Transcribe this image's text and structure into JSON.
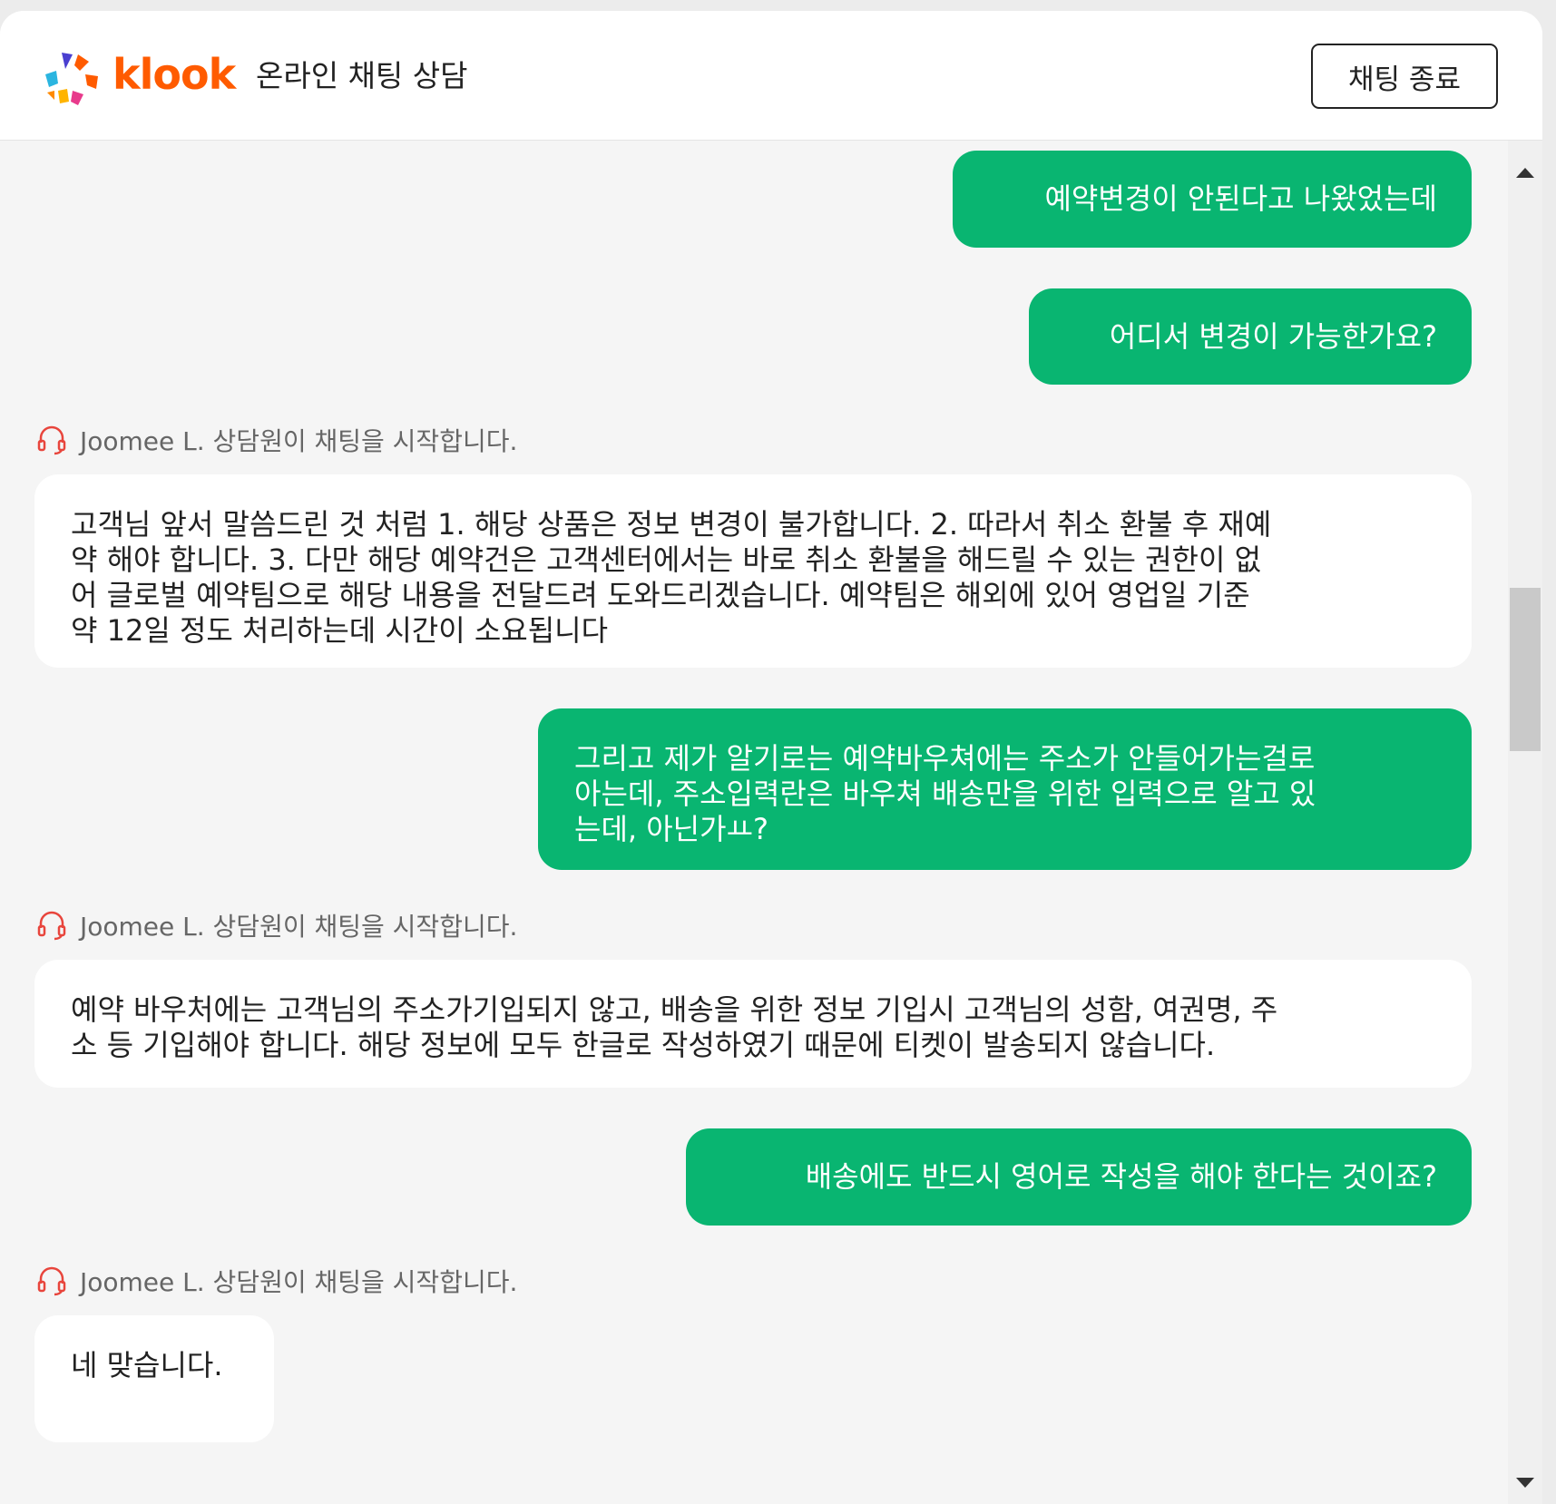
{
  "header": {
    "brand": "klook",
    "title": "온라인 채팅 상담",
    "end_chat_label": "채팅 종료"
  },
  "messages": {
    "m1": "예약변경이 안된다고 나왔었는데",
    "m2": "어디서 변경이 가능한가요?",
    "sys1": "Joomee L. 상담원이 채팅을 시작합니다.",
    "a1_lines": [
      "고객님 앞서 말씀드린 것 처럼  1. 해당 상품은 정보 변경이 불가합니다.  2. 따라서 취소 환불 후 재예",
      "약 해야 합니다.  3. 다만 해당 예약건은 고객센터에서는 바로 취소 환불을 해드릴 수 있는 권한이 없",
      "어 글로벌 예약팀으로 해당 내용을 전달드려 도와드리겠습니다. 예약팀은 해외에 있어 영업일 기준",
      "약 12일 정도 처리하는데 시간이 소요됩니다"
    ],
    "m3_lines": [
      "그리고 제가 알기로는 예약바우쳐에는 주소가 안들어가는걸로",
      "아는데, 주소입력란은 바우쳐 배송만을 위한 입력으로 알고 있",
      "는데, 아닌가ㅛ?"
    ],
    "sys2": "Joomee L. 상담원이 채팅을 시작합니다.",
    "a2_lines": [
      "예약 바우처에는 고객님의 주소가기입되지 않고, 배송을 위한 정보 기입시 고객님의 성함, 여권명, 주",
      "소 등 기입해야 합니다. 해당 정보에 모두 한글로 작성하였기 때문에 티켓이 발송되지 않습니다."
    ],
    "m4": "배송에도 반드시 영어로 작성을 해야 한다는 것이죠?",
    "sys3": "Joomee L. 상담원이 채팅을 시작합니다.",
    "a3": "네 맞습니다."
  },
  "colors": {
    "brand_orange": "#ff5b00",
    "user_bubble": "#09b571",
    "agent_bubble": "#ffffff",
    "headset_icon": "#e8453c"
  }
}
